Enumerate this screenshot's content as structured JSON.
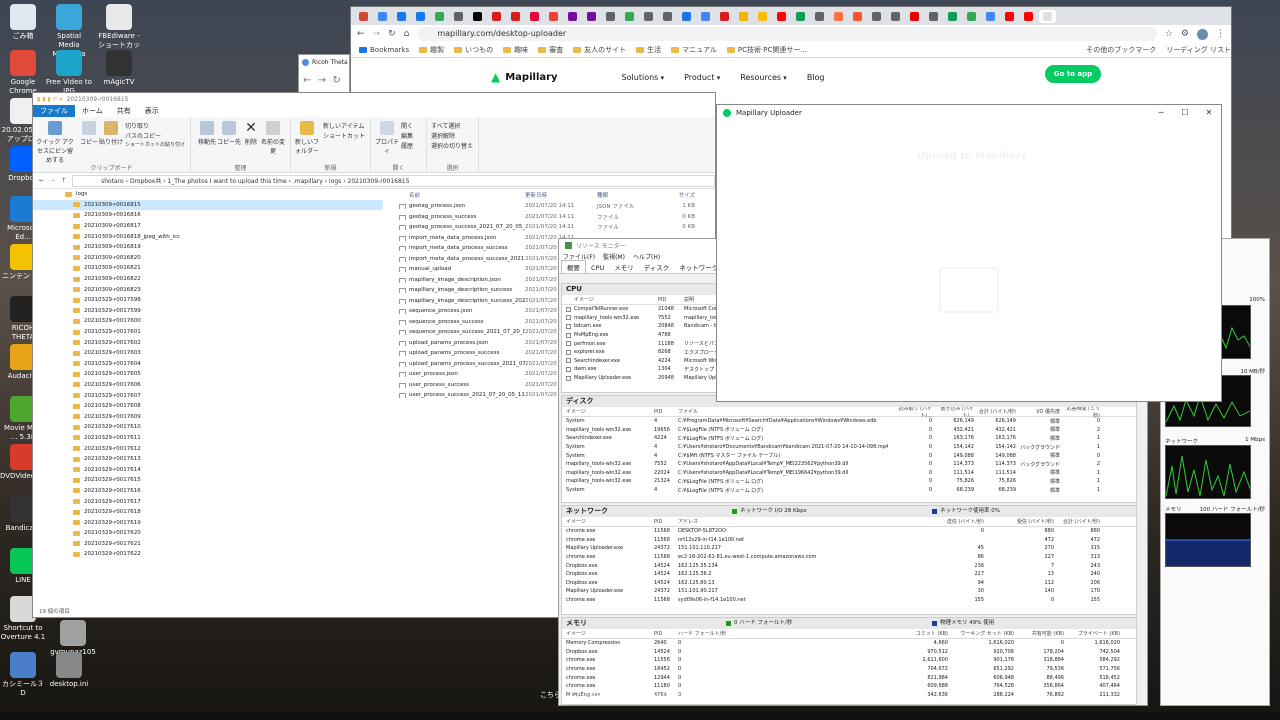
{
  "desktop": {
    "icons": [
      {
        "label": "ごみ箱",
        "color": "#dfe7ef"
      },
      {
        "label": "Spatial Media Metadata Inject...",
        "color": "#3aa7d8"
      },
      {
        "label": "FBEdiware - ショートカット",
        "color": "#e8e8e8"
      },
      {
        "label": "Google Chrome",
        "color": "#e04a3a"
      },
      {
        "label": "Free Video to JPG Converter",
        "color": "#1ca5c8"
      },
      {
        "label": "mAgicTV",
        "color": "#333333"
      },
      {
        "label": "20.02.05 PC アップロ..",
        "color": "#f0f0f0"
      },
      {
        "label": "Dropbox",
        "color": "#0061fe"
      },
      {
        "label": "Microsoft Ed...",
        "color": "#1b7bd4"
      },
      {
        "label": "ニンテンドー",
        "color": "#f3c200"
      },
      {
        "label": "RICOH THETA",
        "color": "#222222"
      },
      {
        "label": "Audacity",
        "color": "#e8a319"
      },
      {
        "label": "Movie Mp3 ... 5.38",
        "color": "#4ca62f"
      },
      {
        "label": "DVDVideoS...",
        "color": "#d83b2a"
      },
      {
        "label": "Bandicam",
        "color": "#333333"
      },
      {
        "label": "LINE",
        "color": "#06c755"
      },
      {
        "label": "Shortcut to Overture 4.1",
        "color": "#d8d8d8"
      },
      {
        "label": "gvmupaz105",
        "color": "#a0a0a0"
      },
      {
        "label": "カシミール３D",
        "color": "#4a7ec9"
      },
      {
        "label": "desktop.ini",
        "color": "#888888"
      }
    ]
  },
  "browser": {
    "url": "mapillary.com/desktop-uploader",
    "tab_colors": [
      "#d44638",
      "#4285f4",
      "#1877f2",
      "#1877f2",
      "#34a853",
      "#5f6368",
      "#000000",
      "#d81b1b",
      "#d81b1b",
      "#e4003a",
      "#ea4335",
      "#720e9e",
      "#720e9e",
      "#5f6368",
      "#34a853",
      "#5f6368",
      "#5f6368",
      "#1a73e8",
      "#4285f4",
      "#d81b1b",
      "#f4b400",
      "#fbbc04",
      "#ff0000",
      "#0f9d58",
      "#5f6368",
      "#ff7043",
      "#fb542b",
      "#5f6368",
      "#5f6368",
      "#e60000",
      "#5f6368",
      "#0f9d58",
      "#34a853",
      "#4285f4",
      "#ff0000",
      "#ff0000",
      "#e0e0e0"
    ],
    "bookmarks": [
      "Bookmarks",
      "趣製",
      "いつもの",
      "趣味",
      "審査",
      "友人のサイト",
      "生活",
      "マニュアル",
      "PC技術·PC関連サー..."
    ],
    "bookmarks_right": [
      "その他のブックマーク",
      "リーディング リスト"
    ],
    "site": {
      "logo": "Mapillary",
      "nav": [
        "Solutions",
        "Product",
        "Resources",
        "Blog"
      ],
      "cta": "Go to app"
    }
  },
  "explorer": {
    "title": "20210309-r0016815",
    "menu": [
      "ファイル",
      "ホーム",
      "共有",
      "表示"
    ],
    "ribbon": {
      "clipboard": {
        "label": "クリップボード",
        "pin": "クイック アクセスにピン留めする",
        "copy": "コピー",
        "paste": "貼り付け",
        "cut": "切り取り",
        "copy_path": "パスのコピー",
        "paste_shortcut": "ショートカットの貼り付け"
      },
      "organize": {
        "label": "整理",
        "move": "移動先",
        "copyto": "コピー先",
        "delete": "削除",
        "rename": "名前の変更"
      },
      "new": {
        "label": "新規",
        "new_folder": "新しいフォルダー",
        "new_item": "新しいアイテム",
        "shortcut": "ショートカット"
      },
      "open": {
        "label": "開く",
        "properties": "プロパティ",
        "open": "開く",
        "edit": "編集",
        "history": "履歴"
      },
      "select": {
        "label": "選択",
        "all": "すべて選択",
        "none": "選択解除",
        "invert": "選択の切り替え"
      }
    },
    "path": "shotaro  ›  Dropbox共  ›  1_The photos I want to upload this time  ›  .mapillary  ›  logs  ›  20210309-r0016815",
    "tree_root": "logs",
    "tree": [
      "20210309-r0016815",
      "20210309-r0016816",
      "20210309-r0016817",
      "20210309-r0016818_jpeg_with_icc",
      "20210309-r0016819",
      "20210309-r0016820",
      "20210309-r0016821",
      "20210309-r0016822",
      "20210309-r0016823",
      "20210329-r0017598",
      "20210329-r0017599",
      "20210329-r0017600",
      "20210329-r0017601",
      "20210329-r0017602",
      "20210329-r0017603",
      "20210329-r0017604",
      "20210329-r0017605",
      "20210329-r0017606",
      "20210329-r0017607",
      "20210329-r0017608",
      "20210329-r0017609",
      "20210329-r0017610",
      "20210329-r0017611",
      "20210329-r0017612",
      "20210329-r0017613",
      "20210329-r0017614",
      "20210329-r0017615",
      "20210329-r0017616",
      "20210329-r0017617",
      "20210329-r0017618",
      "20210329-r0017619",
      "20210329-r0017620",
      "20210329-r0017621",
      "20210329-r0017622"
    ],
    "columns": [
      "名前",
      "更新日時",
      "種類",
      "サイズ"
    ],
    "files": [
      {
        "name": "geotag_process.json",
        "date": "2021/07/20 14:11",
        "type": "JSON ファイル",
        "size": "1 KB"
      },
      {
        "name": "geotag_process_success",
        "date": "2021/07/20 14:11",
        "type": "ファイル",
        "size": "0 KB"
      },
      {
        "name": "geotag_process_success_2021_07_20_05_...",
        "date": "2021/07/20 14:11",
        "type": "ファイル",
        "size": "0 KB"
      },
      {
        "name": "import_meta_data_process.json",
        "date": "2021/07/20 14:11",
        "type": "",
        "size": ""
      },
      {
        "name": "import_meta_data_process_success",
        "date": "2021/07/20 14:11",
        "type": "",
        "size": ""
      },
      {
        "name": "import_meta_data_process_success_2021...",
        "date": "2021/07/20 14:11",
        "type": "",
        "size": ""
      },
      {
        "name": "manual_upload",
        "date": "2021/07/20 14:11",
        "type": "",
        "size": ""
      },
      {
        "name": "mapillary_image_description.json",
        "date": "2021/07/20 14:11",
        "type": "",
        "size": ""
      },
      {
        "name": "mapillary_image_description_success",
        "date": "2021/07/20 14:11",
        "type": "",
        "size": ""
      },
      {
        "name": "mapillary_image_description_success_202...",
        "date": "2021/07/20 14:11",
        "type": "",
        "size": ""
      },
      {
        "name": "sequence_process.json",
        "date": "2021/07/20 14:11",
        "type": "",
        "size": ""
      },
      {
        "name": "sequence_process_success",
        "date": "2021/07/20 14:11",
        "type": "",
        "size": ""
      },
      {
        "name": "sequence_process_success_2021_07_20_0...",
        "date": "2021/07/20 14:11",
        "type": "",
        "size": ""
      },
      {
        "name": "upload_params_process.json",
        "date": "2021/07/20 14:11",
        "type": "",
        "size": ""
      },
      {
        "name": "upload_params_process_success",
        "date": "2021/07/20 14:11",
        "type": "",
        "size": ""
      },
      {
        "name": "upload_params_process_success_2021_07...",
        "date": "2021/07/20 14:11",
        "type": "",
        "size": ""
      },
      {
        "name": "user_process.json",
        "date": "2021/07/20 14:11",
        "type": "",
        "size": ""
      },
      {
        "name": "user_process_success",
        "date": "2021/07/20 14:11",
        "type": "",
        "size": ""
      },
      {
        "name": "user_process_success_2021_07_20_05_11_45",
        "date": "2021/07/20 14:11",
        "type": "",
        "size": ""
      }
    ],
    "status": "19 個の項目"
  },
  "resmon": {
    "title": "リソース モニター",
    "menu": [
      "ファイル(F)",
      "監視(M)",
      "ヘルプ(H)"
    ],
    "tabs": [
      "概要",
      "CPU",
      "メモリ",
      "ディスク",
      "ネットワーク"
    ],
    "cpu": {
      "label": "CPU",
      "columns": [
        "イメージ",
        "PID",
        "説明"
      ],
      "rows": [
        [
          "CompatTelRunner.exe",
          "21048",
          "Microsoft Comp..."
        ],
        [
          "mapillary_tools-win32.exe",
          "7552",
          "mapillary_tool..."
        ],
        [
          "bdcam.exe",
          "20848",
          "Bandicam - bdc..."
        ],
        [
          "MsMpEng.exe",
          "4788",
          ""
        ],
        [
          "perfmon.exe",
          "11188",
          "リソースとパフォ..."
        ],
        [
          "explorer.exe",
          "8268",
          "エクスプローラー"
        ],
        [
          "SearchIndexer.exe",
          "4224",
          "Microsoft Wind..."
        ],
        [
          "dwm.exe",
          "1304",
          "デスクトップ ウィ..."
        ],
        [
          "Mapillary Uploader.exe",
          "20948",
          "Mapillary Uplo..."
        ]
      ]
    },
    "disk": {
      "label": "ディスク",
      "columns": [
        "イメージ",
        "PID",
        "ファイル",
        "読み取り (バイト/...",
        "書き込み (バイト/...",
        "合計 (バイト/秒)",
        "I/O 優先度",
        "応答時間 (ミリ秒)"
      ],
      "rows": [
        [
          "System",
          "4",
          "C:¥ProgramData¥Microsoft¥Search¥Data¥Applications¥Windows¥Windows.edb",
          "0",
          "626,149",
          "626,149",
          "標準",
          "0"
        ],
        [
          "mapillary_tools-win32.exe",
          "19656",
          "C:¥$LogFile (NTFS ボリューム ログ)",
          "0",
          "432,421",
          "432,421",
          "標準",
          "2"
        ],
        [
          "SearchIndexer.exe",
          "4224",
          "C:¥$LogFile (NTFS ボリューム ログ)",
          "0",
          "163,176",
          "163,176",
          "標準",
          "1"
        ],
        [
          "System",
          "4",
          "C:¥Users¥shotaro¥Documents¥Bandicam¥bandicam 2021-07-20 14-10-14-098.mp4",
          "0",
          "154,142",
          "154,142",
          "バックグラウンド",
          "1"
        ],
        [
          "System",
          "4",
          "C:¥$Mft (NTFS マスター ファイル テーブル)",
          "0",
          "149,088",
          "149,088",
          "標準",
          "0"
        ],
        [
          "mapillary_tools-win32.exe",
          "7552",
          "C:¥Users¥shotaro¥AppData¥Local¥Temp¥_MEI223562¥python39.dll",
          "0",
          "114,373",
          "114,373",
          "バックグラウンド",
          "2"
        ],
        [
          "mapillary_tools-win32.exe",
          "22024",
          "C:¥Users¥shotaro¥AppData¥Local¥Temp¥_MEI196642¥python39.dll",
          "0",
          "111,514",
          "111,514",
          "標準",
          "1"
        ],
        [
          "mapillary_tools-win32.exe",
          "21324",
          "C:¥$LogFile (NTFS ボリューム ログ)",
          "0",
          "75,826",
          "75,826",
          "標準",
          "1"
        ],
        [
          "System",
          "4",
          "C:¥$LogFile (NTFS ボリューム ログ)",
          "0",
          "68,239",
          "68,239",
          "標準",
          "1"
        ]
      ]
    },
    "network": {
      "label": "ネットワーク",
      "io": "ネットワーク I/O 28 Kbps",
      "usage": "ネットワーク使用率 0%",
      "columns": [
        "イメージ",
        "PID",
        "アドレス",
        "送信 (バイト/秒)",
        "受信 (バイト/秒)",
        "合計 (バイト/秒)"
      ],
      "rows": [
        [
          "chrome.exe",
          "11568",
          "DESKTOP-5L8T2OO",
          "0",
          "880",
          "880"
        ],
        [
          "chrome.exe",
          "11568",
          "nrt12s29-in-f14.1e100.net",
          "",
          "472",
          "472"
        ],
        [
          "Mapillary Uploader.exe",
          "24372",
          "151.101.110.217",
          "45",
          "270",
          "315"
        ],
        [
          "chrome.exe",
          "11568",
          "ec2-18-202-61-81.eu-west-1.compute.amazonaws.com",
          "86",
          "227",
          "313"
        ],
        [
          "Dropbox.exe",
          "14524",
          "162.125.35.134",
          "236",
          "7",
          "243"
        ],
        [
          "Dropbox.exe",
          "14524",
          "162.125.36.2",
          "227",
          "13",
          "240"
        ],
        [
          "Dropbox.exe",
          "14524",
          "162.125.80.13",
          "94",
          "112",
          "206"
        ],
        [
          "Mapillary Uploader.exe",
          "24372",
          "151.101.90.217",
          "30",
          "140",
          "170"
        ],
        [
          "chrome.exe",
          "11568",
          "syd09s06-in-f14.1e100.net",
          "155",
          "0",
          "155"
        ]
      ]
    },
    "memory": {
      "label": "メモリ",
      "faults": "0 ハード フォールト/秒",
      "used": "物理メモリ 49% 使用",
      "columns": [
        "イメージ",
        "PID",
        "ハード フォールト/秒",
        "コミット (KB)",
        "ワーキング セット (KB)",
        "共有可能 (KB)",
        "プライベート (KB)"
      ],
      "rows": [
        [
          "Memory Compression",
          "2640",
          "0",
          "4,660",
          "1,616,020",
          "0",
          "1,616,020"
        ],
        [
          "Dropbox.exe",
          "14524",
          "0",
          "970,512",
          "920,708",
          "178,204",
          "742,504"
        ],
        [
          "chrome.exe",
          "11556",
          "0",
          "2,611,600",
          "901,176",
          "318,884",
          "584,292"
        ],
        [
          "chrome.exe",
          "18452",
          "0",
          "704,672",
          "651,292",
          "79,536",
          "571,756"
        ],
        [
          "chrome.exe",
          "12944",
          "0",
          "821,984",
          "606,948",
          "88,496",
          "518,452"
        ],
        [
          "chrome.exe",
          "11180",
          "0",
          "609,688",
          "764,528",
          "356,864",
          "407,464"
        ],
        [
          "MsMpEng.exe",
          "4788",
          "0",
          "342,636",
          "288,224",
          "76,892",
          "211,332"
        ]
      ]
    }
  },
  "uploader": {
    "title": "Mapillary Uploader",
    "heading": "Upload to Mapillary"
  },
  "perf": {
    "labels": [
      "100%",
      "10 MB/秒",
      "ネットワーク",
      "1 Mbps",
      "メモリ",
      "100 ハード フォールト/秒"
    ]
  },
  "ricoh": {
    "title": "Ricoh Theta"
  },
  "bottom_text": "こちらはまでの保存画像(Mapillary分)のあとGoogle(Map)へ追加にも適用します"
}
